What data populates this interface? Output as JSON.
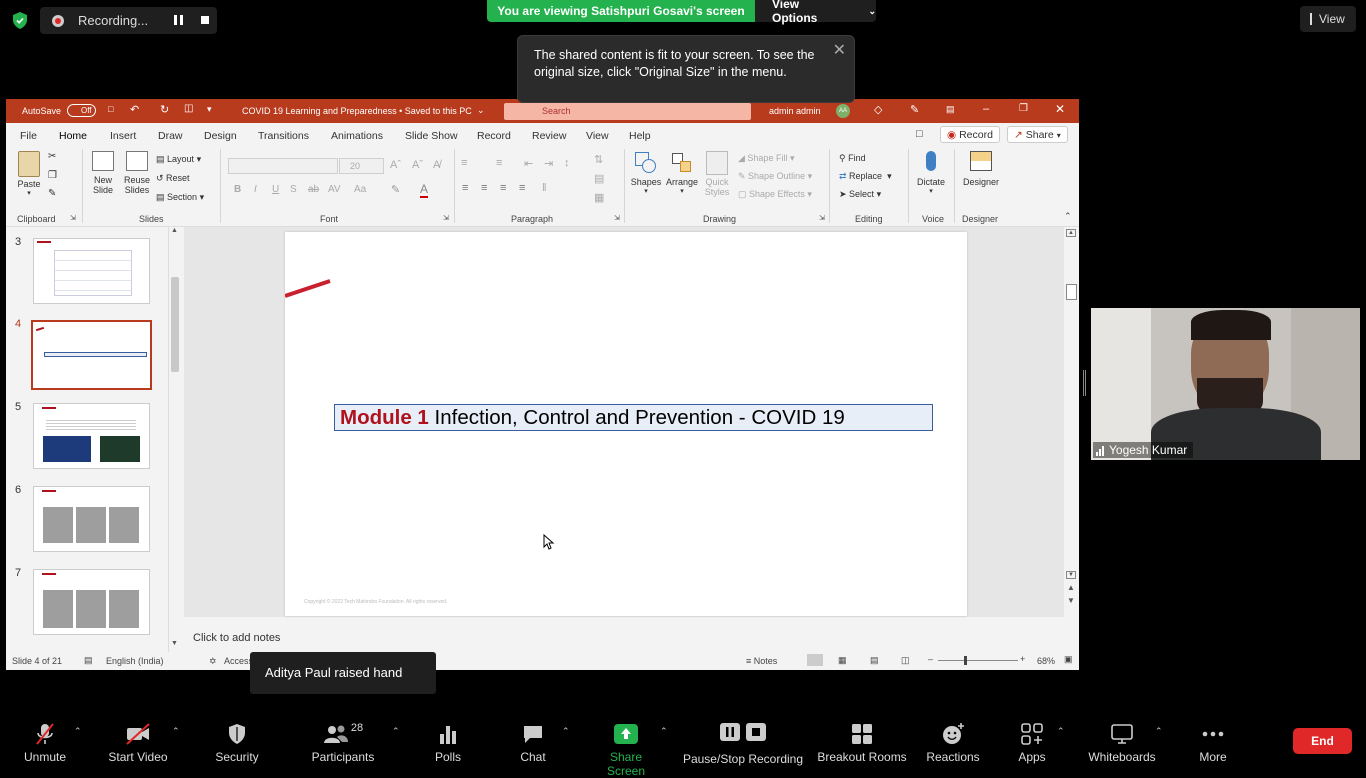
{
  "zoom": {
    "recording_label": "Recording...",
    "share_banner": "You are viewing Satishpuri Gosavi's screen",
    "view_options": "View Options",
    "view_button": "View",
    "tooltip": "The shared content is fit to your screen. To see the original size, click \"Original Size\" in the menu.",
    "participant_video_name": "Yogesh Kumar",
    "raised_hand_notice": "Aditya Paul raised hand",
    "toolbar": {
      "unmute": "Unmute",
      "start_video": "Start Video",
      "security": "Security",
      "participants": "Participants",
      "participants_count": "28",
      "polls": "Polls",
      "chat": "Chat",
      "share_screen": "Share Screen",
      "pause_stop_recording": "Pause/Stop Recording",
      "breakout_rooms": "Breakout Rooms",
      "reactions": "Reactions",
      "apps": "Apps",
      "whiteboards": "Whiteboards",
      "more": "More",
      "end": "End"
    }
  },
  "ppt": {
    "autosave": "AutoSave",
    "autosave_state": "Off",
    "doc_title": "COVID 19 Learning and Preparedness • Saved to this PC",
    "search_placeholder": "Search",
    "user": "admin admin",
    "user_initials": "AA",
    "menu": [
      "File",
      "Home",
      "Insert",
      "Draw",
      "Design",
      "Transitions",
      "Animations",
      "Slide Show",
      "Record",
      "Review",
      "View",
      "Help"
    ],
    "record_btn": "Record",
    "share_btn": "Share",
    "ribbon": {
      "paste": "Paste",
      "clipboard": "Clipboard",
      "new_slide": "New Slide",
      "reuse_slides": "Reuse Slides",
      "layout": "Layout",
      "reset": "Reset",
      "section": "Section",
      "slides": "Slides",
      "font_size": "20",
      "font": "Font",
      "paragraph": "Paragraph",
      "shapes": "Shapes",
      "arrange": "Arrange",
      "quick_styles": "Quick Styles",
      "shape_fill": "Shape Fill",
      "shape_outline": "Shape Outline",
      "shape_effects": "Shape Effects",
      "drawing": "Drawing",
      "find": "Find",
      "replace": "Replace",
      "select": "Select",
      "editing": "Editing",
      "dictate": "Dictate",
      "voice": "Voice",
      "designer": "Designer",
      "designer_group": "Designer"
    },
    "thumb_numbers": [
      "3",
      "4",
      "5",
      "6",
      "7"
    ],
    "slide_title_module": "Module 1",
    "slide_title_rest": " Infection, Control and Prevention - COVID 19",
    "slide_footer": "Copyright © 2022 Tech Mahindra Foundation. All rights reserved.",
    "notes_placeholder": "Click to add notes",
    "status": {
      "slide_count": "Slide 4 of 21",
      "language": "English (India)",
      "accessibility": "Access",
      "notes": "Notes",
      "zoom": "68%"
    }
  }
}
